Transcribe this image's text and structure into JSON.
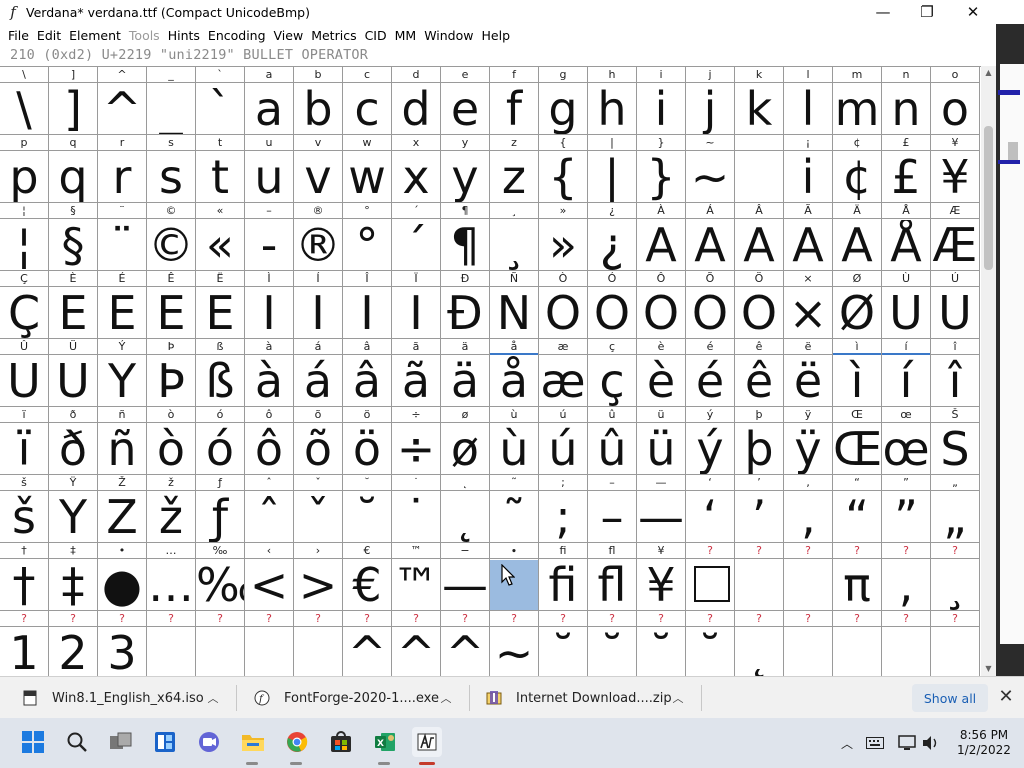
{
  "window": {
    "icon_glyph": "f",
    "title": "Verdana*  verdana.ttf (Compact UnicodeBmp)",
    "minimize_glyph": "—",
    "maximize_glyph": "❐",
    "close_glyph": "✕"
  },
  "menu": [
    "File",
    "Edit",
    "Element",
    "Tools",
    "Hints",
    "Encoding",
    "View",
    "Metrics",
    "CID",
    "MM",
    "Window",
    "Help"
  ],
  "menu_disabled": [
    "Tools"
  ],
  "info_line": "210 (0xd2) U+2219 \"uni2219\" BULLET OPERATOR",
  "grid": {
    "rows": [
      {
        "labels": [
          "\\",
          "]",
          "^",
          "_",
          "`",
          "a",
          "b",
          "c",
          "d",
          "e",
          "f",
          "g",
          "h",
          "i",
          "j",
          "k",
          "l",
          "m",
          "n",
          "o"
        ],
        "glyphs": [
          "\\",
          "]",
          "^",
          "_",
          "`",
          "a",
          "b",
          "c",
          "d",
          "e",
          "f",
          "g",
          "h",
          "i",
          "j",
          "k",
          "l",
          "m",
          "n",
          "o"
        ]
      },
      {
        "labels": [
          "p",
          "q",
          "r",
          "s",
          "t",
          "u",
          "v",
          "w",
          "x",
          "y",
          "z",
          "{",
          "|",
          "}",
          "~",
          "",
          "¡",
          "¢",
          "£",
          "¥"
        ],
        "glyphs": [
          "p",
          "q",
          "r",
          "s",
          "t",
          "u",
          "v",
          "w",
          "x",
          "y",
          "z",
          "{",
          "|",
          "}",
          "~",
          "",
          "i",
          "¢",
          "£",
          "¥"
        ]
      },
      {
        "labels": [
          "¦",
          "§",
          "¨",
          "©",
          "«",
          "–",
          "®",
          "°",
          "´",
          "¶",
          "¸",
          "»",
          "¿",
          "À",
          "Á",
          "Â",
          "Ã",
          "Ä",
          "Å",
          "Æ"
        ],
        "glyphs": [
          "¦",
          "§",
          "¨",
          "©",
          "«",
          "-",
          "®",
          "°",
          "´",
          "¶",
          "¸",
          "»",
          "¿",
          "A",
          "A",
          "A",
          "A",
          "A",
          "Å",
          "Æ"
        ]
      },
      {
        "labels": [
          "Ç",
          "È",
          "É",
          "Ê",
          "Ë",
          "Ì",
          "Í",
          "Î",
          "Ï",
          "Ð",
          "Ñ",
          "Ò",
          "Ó",
          "Ô",
          "Õ",
          "Ö",
          "×",
          "Ø",
          "Ù",
          "Ú"
        ],
        "glyphs": [
          "Ç",
          "E",
          "E",
          "E",
          "E",
          "I",
          "I",
          "I",
          "I",
          "Đ",
          "N",
          "O",
          "O",
          "O",
          "O",
          "O",
          "×",
          "Ø",
          "U",
          "U"
        ]
      },
      {
        "labels": [
          "Û",
          "Ü",
          "Ý",
          "Þ",
          "ß",
          "à",
          "á",
          "â",
          "ã",
          "ä",
          "å",
          "æ",
          "ç",
          "è",
          "é",
          "ê",
          "ë",
          "ì",
          "í",
          "î"
        ],
        "glyphs": [
          "U",
          "U",
          "Y",
          "Þ",
          "ß",
          "à",
          "á",
          "â",
          "ã",
          "ä",
          "å",
          "æ",
          "ç",
          "è",
          "é",
          "ê",
          "ë",
          "ì",
          "í",
          "î"
        ]
      },
      {
        "labels": [
          "ï",
          "ð",
          "ñ",
          "ò",
          "ó",
          "ô",
          "õ",
          "ö",
          "÷",
          "ø",
          "ù",
          "ú",
          "û",
          "ü",
          "ý",
          "þ",
          "ÿ",
          "Œ",
          "œ",
          "Š"
        ],
        "glyphs": [
          "ï",
          "ð",
          "ñ",
          "ò",
          "ó",
          "ô",
          "õ",
          "ö",
          "÷",
          "ø",
          "ù",
          "ú",
          "û",
          "ü",
          "ý",
          "þ",
          "ÿ",
          "Œ",
          "œ",
          "S"
        ]
      },
      {
        "labels": [
          "š",
          "Ÿ",
          "Ž",
          "ž",
          "ƒ",
          "ˆ",
          "ˇ",
          "˘",
          "˙",
          "˛",
          "˜",
          ";",
          "–",
          "—",
          "‘",
          "’",
          "‚",
          "“",
          "”",
          "„"
        ],
        "glyphs": [
          "š",
          "Y",
          "Z",
          "ž",
          "ƒ",
          "ˆ",
          "ˇ",
          "˘",
          "˙",
          "˛",
          "˜",
          ";",
          "–",
          "—",
          "‘",
          "’",
          "‚",
          "“",
          "”",
          "„"
        ]
      },
      {
        "labels": [
          "†",
          "‡",
          "•",
          "…",
          "‰",
          "‹",
          "›",
          "€",
          "™",
          "−",
          "∙",
          "ﬁ",
          "ﬂ",
          "¥",
          "?",
          "?",
          "?",
          "?",
          "?",
          "?"
        ],
        "glyphs": [
          "†",
          "‡",
          "●",
          "…",
          "‰",
          "<",
          ">",
          "€",
          "™",
          "—",
          "",
          "ﬁ",
          "ﬂ",
          "¥",
          "",
          "",
          "",
          "π",
          ",",
          "¸"
        ]
      },
      {
        "labels": [
          "?",
          "?",
          "?",
          "?",
          "?",
          "?",
          "?",
          "?",
          "?",
          "?",
          "?",
          "?",
          "?",
          "?",
          "?",
          "?",
          "?",
          "?",
          "?",
          "?"
        ],
        "glyphs": [
          "1",
          "2",
          "3",
          "",
          "",
          "",
          "",
          "^",
          "^",
          "^",
          "~",
          "˘",
          "˘",
          "˘",
          "˘",
          "˛",
          "",
          "",
          "",
          ""
        ]
      }
    ]
  },
  "downloads": [
    {
      "name": "Win8.1_English_x64.iso",
      "icon": "iso-file-icon"
    },
    {
      "name": "FontForge-2020-1....exe",
      "icon": "fontforge-installer-icon"
    },
    {
      "name": "Internet Download....zip",
      "icon": "zip-archive-icon"
    }
  ],
  "downloads_show_all": "Show all",
  "taskbar": {
    "time": "8:56 PM",
    "date": "1/2/2022",
    "apps": [
      "start",
      "search",
      "task-view",
      "widgets",
      "teams-chat",
      "file-explorer",
      "chrome",
      "microsoft-store",
      "excel",
      "fontforge"
    ]
  },
  "colors": {
    "highlight": "#9bbbe0",
    "missing_label": "#cc3344",
    "grid_lines": "#9a9a9a"
  }
}
